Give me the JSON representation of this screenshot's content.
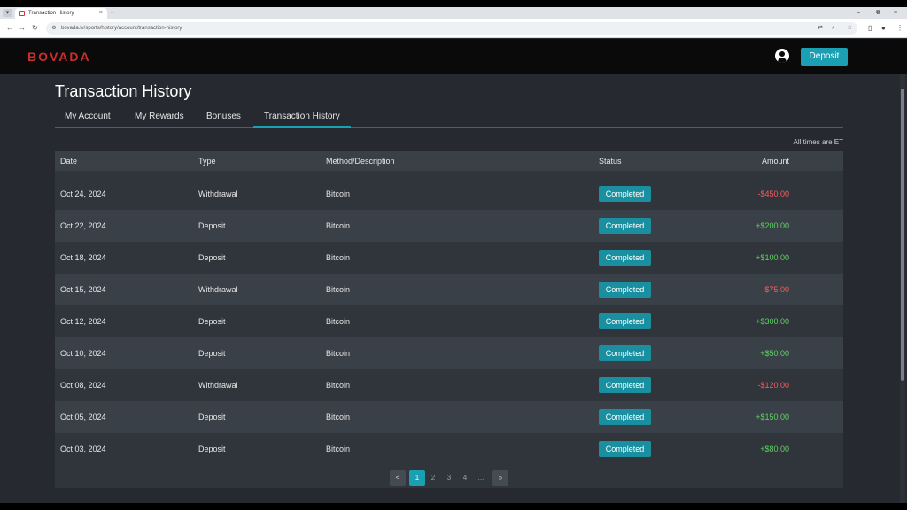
{
  "browser": {
    "tab_title": "Transaction History",
    "tab_close": "×",
    "new_tab": "+",
    "url": "bovada.lv/sports/history/account/transaction-history",
    "window_controls": [
      "–",
      "⧉",
      "×"
    ]
  },
  "site": {
    "logo": "BOVADA",
    "deposit_label": "Deposit",
    "brand_color": "#c9302c",
    "accent_color": "#1aa0b2"
  },
  "page": {
    "title": "Transaction History",
    "tabs": [
      "My Account",
      "My Rewards",
      "Bonuses",
      "Transaction History"
    ],
    "active_tab": "Transaction History",
    "timezone_note": "All times are ET"
  },
  "table": {
    "headers": {
      "date": "Date",
      "type": "Type",
      "method": "Method/Description",
      "status": "Status",
      "amount": "Amount"
    },
    "rows": [
      {
        "date": "Oct 24, 2024",
        "type": "Withdrawal",
        "method": "Bitcoin",
        "status": "Completed",
        "amount": "-$450.00"
      },
      {
        "date": "Oct 22, 2024",
        "type": "Deposit",
        "method": "Bitcoin",
        "status": "Completed",
        "amount": "+$200.00"
      },
      {
        "date": "Oct 18, 2024",
        "type": "Deposit",
        "method": "Bitcoin",
        "status": "Completed",
        "amount": "+$100.00"
      },
      {
        "date": "Oct 15, 2024",
        "type": "Withdrawal",
        "method": "Bitcoin",
        "status": "Completed",
        "amount": "-$75.00"
      },
      {
        "date": "Oct 12, 2024",
        "type": "Deposit",
        "method": "Bitcoin",
        "status": "Completed",
        "amount": "+$300.00"
      },
      {
        "date": "Oct 10, 2024",
        "type": "Deposit",
        "method": "Bitcoin",
        "status": "Completed",
        "amount": "+$50.00"
      },
      {
        "date": "Oct 08, 2024",
        "type": "Withdrawal",
        "method": "Bitcoin",
        "status": "Completed",
        "amount": "-$120.00"
      },
      {
        "date": "Oct 05, 2024",
        "type": "Deposit",
        "method": "Bitcoin",
        "status": "Completed",
        "amount": "+$150.00"
      },
      {
        "date": "Oct 03, 2024",
        "type": "Deposit",
        "method": "Bitcoin",
        "status": "Completed",
        "amount": "+$80.00"
      }
    ],
    "positive_color": "#5fd35f",
    "negative_color": "#ff5a5a"
  },
  "pagination": {
    "prev": "<",
    "pages": [
      "1",
      "2",
      "3",
      "4"
    ],
    "ellipsis": "...",
    "next": "»",
    "current": "1"
  }
}
